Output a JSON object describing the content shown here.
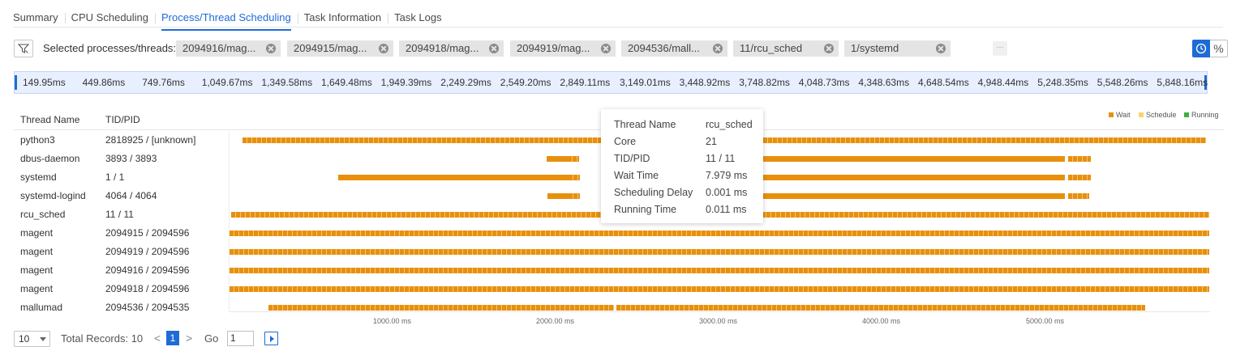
{
  "tabs": [
    {
      "label": "Summary",
      "active": false
    },
    {
      "label": "CPU Scheduling",
      "active": false
    },
    {
      "label": "Process/Thread Scheduling",
      "active": true
    },
    {
      "label": "Task Information",
      "active": false
    },
    {
      "label": "Task Logs",
      "active": false
    }
  ],
  "filter": {
    "label": "Selected processes/threads:",
    "chips": [
      "2094916/mag...",
      "2094915/mag...",
      "2094918/mag...",
      "2094919/mag...",
      "2094536/mall...",
      "11/rcu_sched",
      "1/systemd"
    ],
    "more_label": "···"
  },
  "toolbar": {
    "clock_icon": "clock-icon",
    "percent_label": "%",
    "accent": "#1f6bd6"
  },
  "ruler": {
    "ticks": [
      "149.95ms",
      "449.86ms",
      "749.76ms",
      "1,049.67ms",
      "1,349.58ms",
      "1,649.48ms",
      "1,949.39ms",
      "2,249.29ms",
      "2,549.20ms",
      "2,849.11ms",
      "3,149.01ms",
      "3,448.92ms",
      "3,748.82ms",
      "4,048.73ms",
      "4,348.63ms",
      "4,648.54ms",
      "4,948.44ms",
      "5,248.35ms",
      "5,548.26ms",
      "5,848.16ms"
    ]
  },
  "table": {
    "headers": {
      "name": "Thread Name",
      "tid": "TID/PID"
    },
    "rows": [
      {
        "name": "python3",
        "tid": "2818925 / [unknown]"
      },
      {
        "name": "dbus-daemon",
        "tid": "3893 / 3893"
      },
      {
        "name": "systemd",
        "tid": "1 / 1"
      },
      {
        "name": "systemd-logind",
        "tid": "4064 / 4064"
      },
      {
        "name": "rcu_sched",
        "tid": "11 / 11"
      },
      {
        "name": "magent",
        "tid": "2094915 / 2094596"
      },
      {
        "name": "magent",
        "tid": "2094919 / 2094596"
      },
      {
        "name": "magent",
        "tid": "2094916 / 2094596"
      },
      {
        "name": "magent",
        "tid": "2094918 / 2094596"
      },
      {
        "name": "mallumad",
        "tid": "2094536 / 2094535"
      }
    ]
  },
  "legend": [
    {
      "label": "Wait",
      "color": "#e8900c"
    },
    {
      "label": "Schedule",
      "color": "#f5d76e"
    },
    {
      "label": "Running",
      "color": "#3cb043"
    }
  ],
  "x_axis": [
    "1000.00 ms",
    "2000.00 ms",
    "3000.00 ms",
    "4000.00 ms",
    "5000.00 ms"
  ],
  "tooltip": {
    "rows": [
      {
        "label": "Thread Name",
        "value": "rcu_sched"
      },
      {
        "label": "Core",
        "value": "21"
      },
      {
        "label": "TID/PID",
        "value": "11 / 11"
      },
      {
        "label": "Wait Time",
        "value": "7.979 ms"
      },
      {
        "label": "Scheduling Delay",
        "value": "0.001 ms"
      },
      {
        "label": "Running Time",
        "value": "0.011 ms"
      }
    ]
  },
  "pagination": {
    "page_size": "10",
    "total": "Total Records: 10",
    "prev": "<",
    "current_page": "1",
    "next": ">",
    "go_label": "Go",
    "go_value": "1"
  }
}
